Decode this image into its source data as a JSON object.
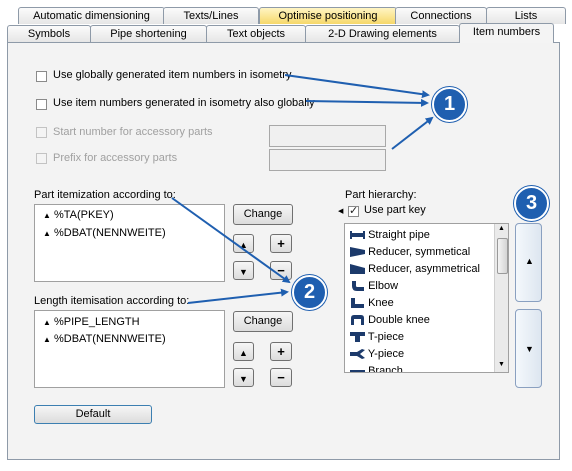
{
  "tabs_row1": [
    "Automatic dimensioning",
    "Texts/Lines",
    "Optimise positioning",
    "Connections",
    "Lists"
  ],
  "tabs_row2": [
    "Symbols",
    "Pipe shortening",
    "Text objects",
    "2-D Drawing elements",
    "Item numbers"
  ],
  "checkboxes": {
    "global_numbers": "Use globally generated item numbers in isometry",
    "iso_numbers": "Use item numbers generated in isometry also globally",
    "start_number": "Start number for accessory parts",
    "prefix": "Prefix for accessory parts"
  },
  "part_itemization": {
    "label": "Part itemization according to:",
    "items": [
      "%TA(PKEY)",
      "%DBAT(NENNWEITE)"
    ],
    "change": "Change",
    "plus": "+",
    "minus": "−"
  },
  "length_itemisation": {
    "label": "Length itemisation according to:",
    "items": [
      "%PIPE_LENGTH",
      "%DBAT(NENNWEITE)"
    ],
    "change": "Change",
    "plus": "+",
    "minus": "−"
  },
  "hierarchy": {
    "label": "Part hierarchy:",
    "use_part_key": "Use part key",
    "items": [
      "Straight pipe",
      "Reducer, symmetical",
      "Reducer, asymmetrical",
      "Elbow",
      "Knee",
      "Double knee",
      "T-piece",
      "Y-piece",
      "Branch"
    ]
  },
  "default_button": "Default",
  "callouts": [
    "1",
    "2",
    "3"
  ],
  "colors": {
    "callout": "#1f5fb0",
    "highlight_tab": "#f6d86a"
  }
}
